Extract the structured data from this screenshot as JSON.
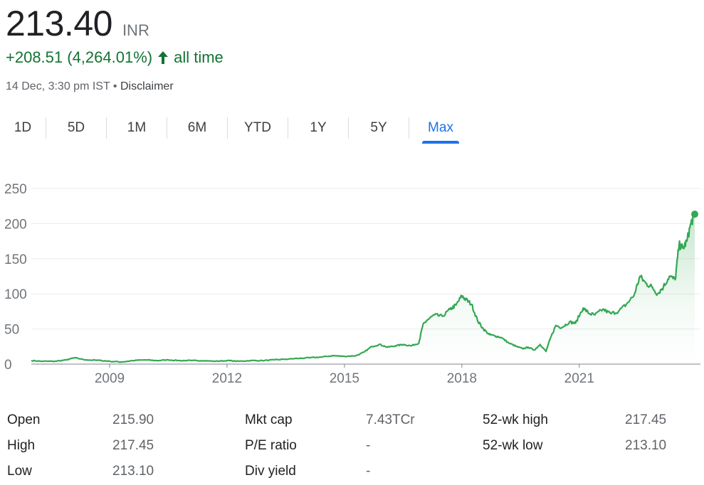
{
  "quote": {
    "price": "213.40",
    "currency": "INR",
    "change": "+208.51 (4,264.01%)",
    "change_period": "all time",
    "timestamp": "14 Dec, 3:30 pm IST",
    "separator": "•",
    "disclaimer": "Disclaimer",
    "up_color": "#137333",
    "line_color": "#34a853"
  },
  "range_tabs": [
    {
      "label": "1D",
      "active": false
    },
    {
      "label": "5D",
      "active": false
    },
    {
      "label": "1M",
      "active": false
    },
    {
      "label": "6M",
      "active": false
    },
    {
      "label": "YTD",
      "active": false
    },
    {
      "label": "1Y",
      "active": false
    },
    {
      "label": "5Y",
      "active": false
    },
    {
      "label": "Max",
      "active": true
    }
  ],
  "stats": {
    "open_label": "Open",
    "open_value": "215.90",
    "high_label": "High",
    "high_value": "217.45",
    "low_label": "Low",
    "low_value": "213.10",
    "mktcap_label": "Mkt cap",
    "mktcap_value": "7.43TCr",
    "pe_label": "P/E ratio",
    "pe_value": "-",
    "div_label": "Div yield",
    "div_value": "-",
    "wk_high_label": "52-wk high",
    "wk_high_value": "217.45",
    "wk_low_label": "52-wk low",
    "wk_low_value": "213.10"
  },
  "chart_data": {
    "type": "area",
    "ylim": [
      0,
      250
    ],
    "y_ticks": [
      0,
      50,
      100,
      150,
      200,
      250
    ],
    "x_ticks": [
      "2009",
      "2012",
      "2015",
      "2018",
      "2021"
    ],
    "x_tick_years": [
      2009,
      2012,
      2015,
      2018,
      2021
    ],
    "xlim": [
      2007.0,
      2023.95
    ],
    "grid": true,
    "series": [
      {
        "x": [
          2007.0,
          2007.3,
          2007.6,
          2007.9,
          2008.1,
          2008.4,
          2008.8,
          2009.0,
          2009.3,
          2009.6,
          2009.9,
          2010.2,
          2010.5,
          2010.8,
          2011.1,
          2011.4,
          2011.7,
          2012.0,
          2012.3,
          2012.6,
          2012.9,
          2013.2,
          2013.5,
          2013.8,
          2014.1,
          2014.4,
          2014.7,
          2015.0,
          2015.3,
          2015.5,
          2015.7,
          2015.9,
          2016.1,
          2016.3,
          2016.5,
          2016.7,
          2016.9,
          2017.0,
          2017.1,
          2017.3,
          2017.5,
          2017.7,
          2017.85,
          2018.0,
          2018.1,
          2018.25,
          2018.4,
          2018.55,
          2018.7,
          2018.85,
          2019.0,
          2019.2,
          2019.4,
          2019.55,
          2019.7,
          2019.85,
          2020.0,
          2020.15,
          2020.25,
          2020.4,
          2020.55,
          2020.75,
          2020.9,
          2021.1,
          2021.25,
          2021.4,
          2021.6,
          2021.8,
          2022.0,
          2022.2,
          2022.4,
          2022.55,
          2022.7,
          2022.85,
          2023.0,
          2023.15,
          2023.3,
          2023.45,
          2023.55,
          2023.65,
          2023.75,
          2023.85,
          2023.95
        ],
        "values": [
          5,
          4,
          4,
          6,
          9,
          6,
          5,
          4,
          3,
          5,
          6,
          5,
          6,
          5,
          5,
          5,
          4,
          5,
          4,
          5,
          5,
          6,
          7,
          8,
          9,
          10,
          12,
          11,
          12,
          17,
          25,
          28,
          24,
          26,
          28,
          26,
          30,
          55,
          62,
          70,
          68,
          78,
          84,
          97,
          92,
          85,
          62,
          50,
          42,
          40,
          38,
          30,
          25,
          22,
          24,
          20,
          28,
          18,
          35,
          55,
          52,
          60,
          58,
          80,
          72,
          70,
          78,
          72,
          75,
          85,
          98,
          125,
          115,
          110,
          100,
          110,
          125,
          120,
          170,
          165,
          175,
          200,
          213.4
        ]
      }
    ]
  }
}
